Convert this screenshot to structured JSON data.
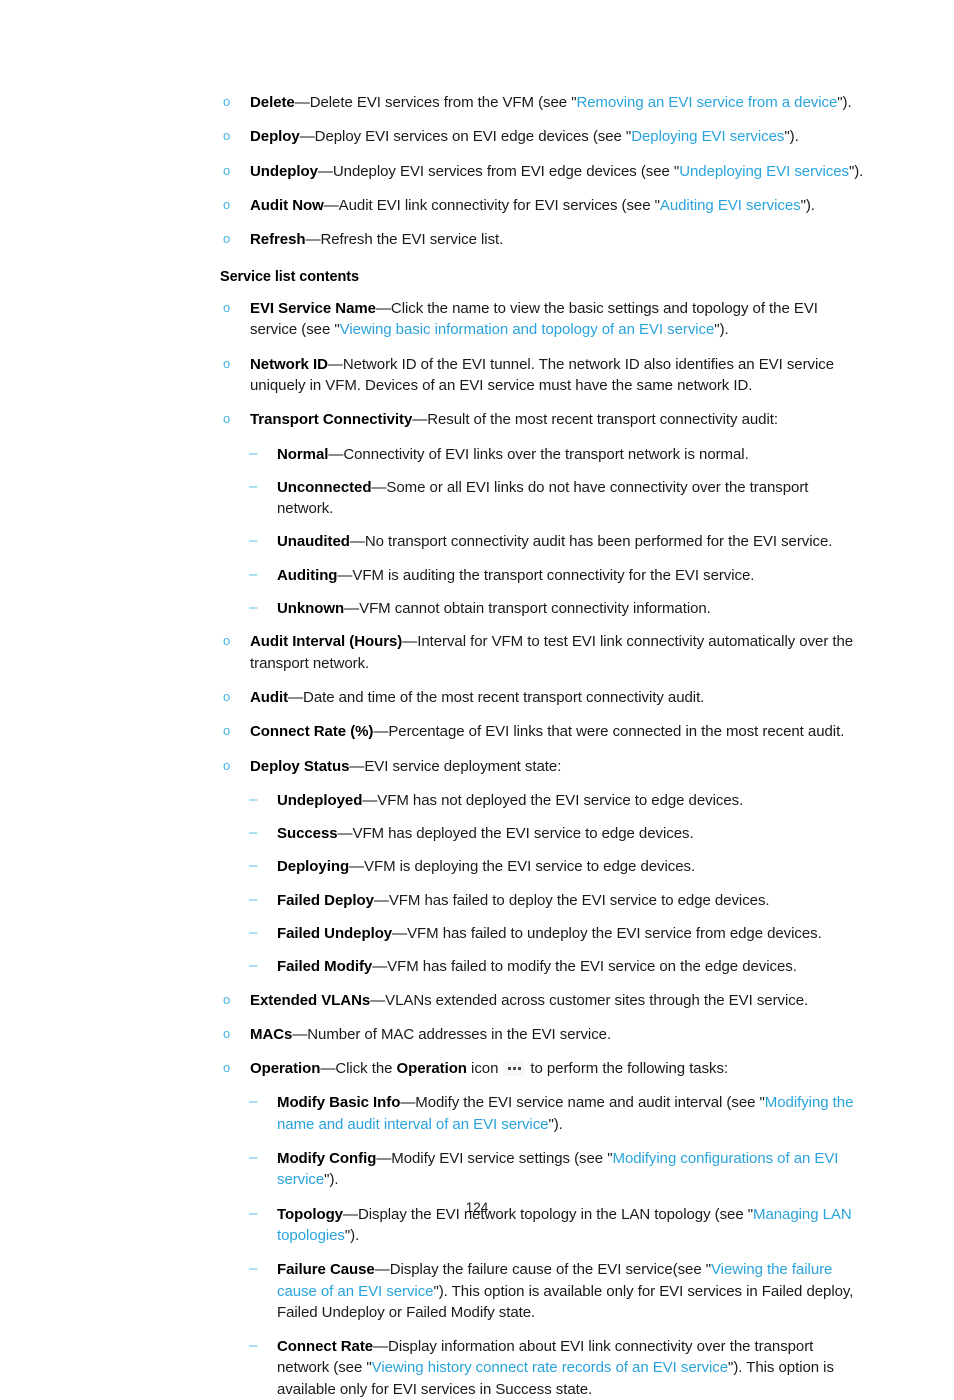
{
  "document": {
    "page_number": "124",
    "link_color": "#29a3dc",
    "bullet_color": "#3cb4e5",
    "dash_color": "#59c0e8"
  },
  "toolbar_items": [
    {
      "term": "Delete",
      "dash": "—",
      "text_before": "Delete EVI services from the VFM (see \"",
      "link": "Removing an EVI service from a device",
      "text_after": "\")."
    },
    {
      "term": "Deploy",
      "dash": "—",
      "text_before": "Deploy EVI services on EVI edge devices (see \"",
      "link": "Deploying EVI services",
      "text_after": "\")."
    },
    {
      "term": "Undeploy",
      "dash": "—",
      "text_before": "Undeploy EVI services from EVI edge devices (see \"",
      "link": "Undeploying EVI services",
      "text_after": "\")."
    },
    {
      "term": "Audit Now",
      "dash": "—",
      "text_before": "Audit EVI link connectivity for EVI services (see \"",
      "link": "Auditing EVI services",
      "text_after": "\")."
    },
    {
      "term": "Refresh",
      "dash": "—",
      "text_before": "Refresh the EVI service list.",
      "link": "",
      "text_after": ""
    }
  ],
  "service_list": {
    "heading": "Service list contents",
    "evi_service_name": {
      "term": "EVI Service Name",
      "dash": "—",
      "text_before": "Click the name to view the basic settings and topology of the EVI service (see \"",
      "link": "Viewing basic information and topology of an EVI service",
      "text_after": "\")."
    },
    "network_id": {
      "term": "Network ID",
      "dash": "—",
      "text": "Network ID of the EVI tunnel. The network ID also identifies an EVI service uniquely in VFM. Devices of an EVI service must have the same network ID."
    },
    "transport_connectivity": {
      "term": "Transport Connectivity",
      "dash": "—",
      "text": "Result of the most recent transport connectivity audit:",
      "states": [
        {
          "term": "Normal",
          "dash": "—",
          "text": "Connectivity of EVI links over the transport network is normal."
        },
        {
          "term": "Unconnected",
          "dash": "—",
          "text": "Some or all EVI links do not have connectivity over the transport network."
        },
        {
          "term": "Unaudited",
          "dash": "—",
          "text": "No transport connectivity audit has been performed for the EVI service."
        },
        {
          "term": "Auditing",
          "dash": "—",
          "text": "VFM is auditing the transport connectivity for the EVI service."
        },
        {
          "term": "Unknown",
          "dash": "—",
          "text": "VFM cannot obtain transport connectivity information."
        }
      ]
    },
    "audit_interval": {
      "term": "Audit Interval (Hours)",
      "dash": "—",
      "text": "Interval for VFM to test EVI link connectivity automatically over the transport network."
    },
    "audit": {
      "term": "Audit",
      "dash": "—",
      "text": "Date and time of the most recent transport connectivity audit."
    },
    "connect_rate": {
      "term": "Connect Rate (%)",
      "dash": "—",
      "text": "Percentage of EVI links that were connected in the most recent audit."
    },
    "deploy_status": {
      "term": "Deploy Status",
      "dash": "—",
      "text": "EVI service deployment state:",
      "states": [
        {
          "term": "Undeployed",
          "dash": "—",
          "text": "VFM has not deployed the EVI service to edge devices."
        },
        {
          "term": "Success",
          "dash": "—",
          "text": "VFM has deployed the EVI service to edge devices."
        },
        {
          "term": "Deploying",
          "dash": "—",
          "text": "VFM is deploying the EVI service to edge devices."
        },
        {
          "term": "Failed Deploy",
          "dash": "—",
          "text": "VFM has failed to deploy the EVI service to edge devices."
        },
        {
          "term": "Failed Undeploy",
          "dash": "—",
          "text": "VFM has failed to undeploy the EVI service from edge devices."
        },
        {
          "term": "Failed Modify",
          "dash": "—",
          "text": "VFM has failed to modify the EVI service on the edge devices."
        }
      ]
    },
    "extended_vlans": {
      "term": "Extended VLANs",
      "dash": "—",
      "text": "VLANs extended across customer sites through the EVI service."
    },
    "macs": {
      "term": "MACs",
      "dash": "—",
      "text": "Number of MAC addresses in the EVI service."
    },
    "operation": {
      "term": "Operation",
      "dash": "—",
      "text_before": "Click the ",
      "term_inline": "Operation",
      "text_mid": " icon",
      "icon": "ellipsis-icon",
      "text_after": "to perform the following tasks:",
      "tasks": [
        {
          "term": "Modify Basic Info",
          "dash": "—",
          "text_before": "Modify the EVI service name and audit interval (see \"",
          "link": "Modifying the name and audit interval of an EVI service",
          "text_after": "\").",
          "text_tail": ""
        },
        {
          "term": "Modify Config",
          "dash": "—",
          "text_before": "Modify EVI service settings (see \"",
          "link": "Modifying configurations of an EVI service",
          "text_after": "\").",
          "text_tail": ""
        },
        {
          "term": "Topology",
          "dash": "—",
          "text_before": "Display the EVI network topology in the LAN topology (see \"",
          "link": "Managing LAN topologies",
          "text_after": "\").",
          "text_tail": ""
        },
        {
          "term": "Failure Cause",
          "dash": "—",
          "text_before": "Display the failure cause of the EVI service(see \"",
          "link": "Viewing the failure cause of an EVI service",
          "text_after": "\").",
          "text_tail": " This option is available only for EVI services in Failed deploy, Failed Undeploy or Failed Modify state."
        },
        {
          "term": "Connect Rate",
          "dash": "—",
          "text_before": "Display information about EVI link connectivity over the transport network (see \"",
          "link": "Viewing history connect rate records of an EVI service",
          "text_after": "\").",
          "text_tail": " This option is available only for EVI services in Success state."
        }
      ]
    }
  }
}
